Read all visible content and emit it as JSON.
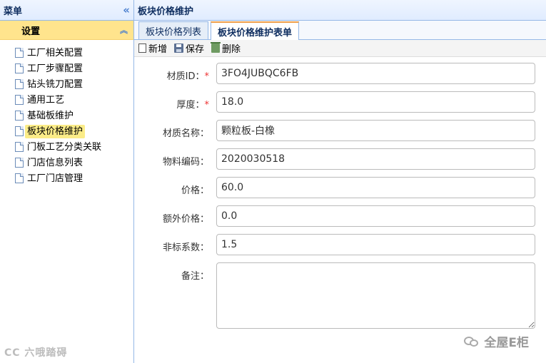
{
  "menu": {
    "title": "菜单",
    "section": "设置",
    "items": [
      {
        "label": "工厂相关配置"
      },
      {
        "label": "工厂步骤配置"
      },
      {
        "label": "钻头铣刀配置"
      },
      {
        "label": "通用工艺"
      },
      {
        "label": "基础板维护"
      },
      {
        "label": "板块价格维护",
        "selected": true
      },
      {
        "label": "门板工艺分类关联"
      },
      {
        "label": "门店信息列表"
      },
      {
        "label": "工厂门店管理"
      }
    ]
  },
  "content": {
    "title": "板块价格维护",
    "tabs": [
      {
        "label": "板块价格列表"
      },
      {
        "label": "板块价格维护表单",
        "active": true
      }
    ],
    "toolbar": {
      "new_label": "新增",
      "save_label": "保存",
      "delete_label": "删除"
    },
    "form": {
      "material_id": {
        "label": "材质ID：",
        "required": "*",
        "value": "3FO4JUBQC6FB"
      },
      "thickness": {
        "label": "厚度：",
        "required": "*",
        "value": "18.0"
      },
      "material_name": {
        "label": "材质名称：",
        "value": "颗粒板-白橡"
      },
      "material_code": {
        "label": "物料编码：",
        "value": "2020030518"
      },
      "price": {
        "label": "价格：",
        "value": "60.0"
      },
      "extra_price": {
        "label": "额外价格：",
        "value": "0.0"
      },
      "nonstandard_factor": {
        "label": "非标系数：",
        "value": "1.5"
      },
      "remark": {
        "label": "备注：",
        "value": ""
      }
    }
  },
  "watermarks": {
    "left": "CC 六哦踏碍",
    "right": "全屋E柜"
  },
  "colors": {
    "header_bg": "#e0ecff",
    "border": "#95b8e7",
    "accordion_bg": "#ffe48d",
    "selected_bg": "#fbec88",
    "active_tab_accent": "#f0a04a",
    "required": "#ee3333"
  }
}
